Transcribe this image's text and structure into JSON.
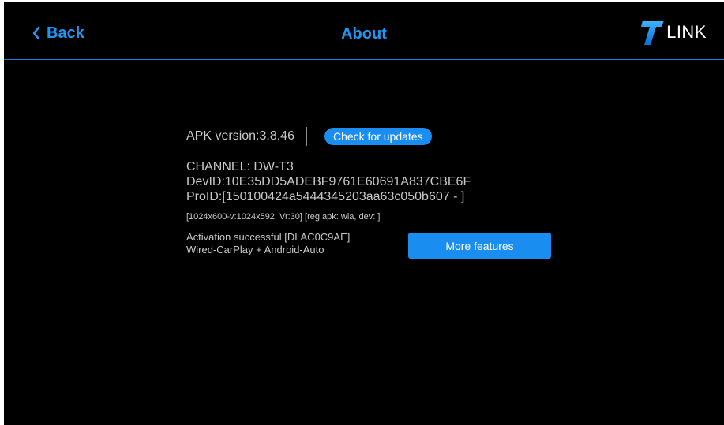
{
  "header": {
    "back_label": "Back",
    "title": "About",
    "logo_text": "LINK",
    "logo_icon": "t-logo-icon",
    "accent_color": "#1f96f2"
  },
  "about": {
    "apk_version": "APK version:3.8.46",
    "check_updates_label": "Check for updates",
    "channel": "CHANNEL: DW-T3",
    "dev_id": "DevID:10E35DD5ADEBF9761E60691A837CBE6F",
    "pro_id": "ProID:[150100424a5444345203aa63c050b607 - ]",
    "resolution_info": "[1024x600-v:1024x592, Vr:30] [reg:apk: wla, dev: ]",
    "activation_status": "Activation successful [DLAC0C9AE]",
    "connection_modes": "Wired-CarPlay + Android-Auto",
    "more_features_label": "More features"
  }
}
